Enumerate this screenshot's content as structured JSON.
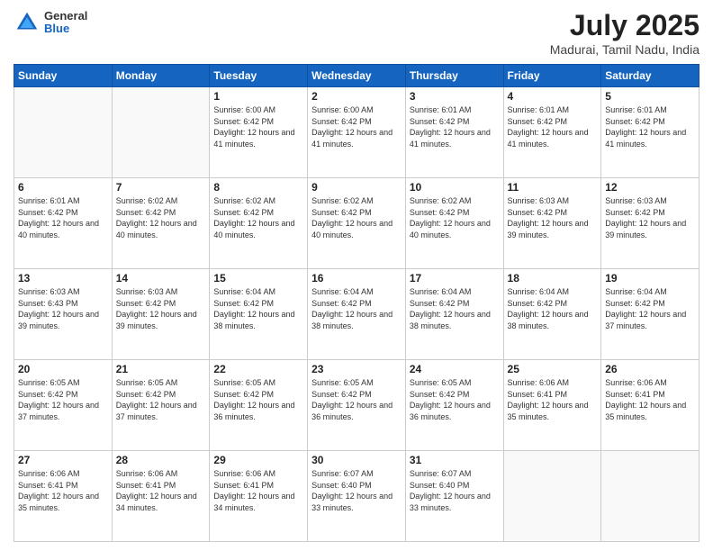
{
  "header": {
    "logo_general": "General",
    "logo_blue": "Blue",
    "title": "July 2025",
    "location": "Madurai, Tamil Nadu, India"
  },
  "weekdays": [
    "Sunday",
    "Monday",
    "Tuesday",
    "Wednesday",
    "Thursday",
    "Friday",
    "Saturday"
  ],
  "weeks": [
    [
      {
        "day": "",
        "sunrise": "",
        "sunset": "",
        "daylight": ""
      },
      {
        "day": "",
        "sunrise": "",
        "sunset": "",
        "daylight": ""
      },
      {
        "day": "1",
        "sunrise": "Sunrise: 6:00 AM",
        "sunset": "Sunset: 6:42 PM",
        "daylight": "Daylight: 12 hours and 41 minutes."
      },
      {
        "day": "2",
        "sunrise": "Sunrise: 6:00 AM",
        "sunset": "Sunset: 6:42 PM",
        "daylight": "Daylight: 12 hours and 41 minutes."
      },
      {
        "day": "3",
        "sunrise": "Sunrise: 6:01 AM",
        "sunset": "Sunset: 6:42 PM",
        "daylight": "Daylight: 12 hours and 41 minutes."
      },
      {
        "day": "4",
        "sunrise": "Sunrise: 6:01 AM",
        "sunset": "Sunset: 6:42 PM",
        "daylight": "Daylight: 12 hours and 41 minutes."
      },
      {
        "day": "5",
        "sunrise": "Sunrise: 6:01 AM",
        "sunset": "Sunset: 6:42 PM",
        "daylight": "Daylight: 12 hours and 41 minutes."
      }
    ],
    [
      {
        "day": "6",
        "sunrise": "Sunrise: 6:01 AM",
        "sunset": "Sunset: 6:42 PM",
        "daylight": "Daylight: 12 hours and 40 minutes."
      },
      {
        "day": "7",
        "sunrise": "Sunrise: 6:02 AM",
        "sunset": "Sunset: 6:42 PM",
        "daylight": "Daylight: 12 hours and 40 minutes."
      },
      {
        "day": "8",
        "sunrise": "Sunrise: 6:02 AM",
        "sunset": "Sunset: 6:42 PM",
        "daylight": "Daylight: 12 hours and 40 minutes."
      },
      {
        "day": "9",
        "sunrise": "Sunrise: 6:02 AM",
        "sunset": "Sunset: 6:42 PM",
        "daylight": "Daylight: 12 hours and 40 minutes."
      },
      {
        "day": "10",
        "sunrise": "Sunrise: 6:02 AM",
        "sunset": "Sunset: 6:42 PM",
        "daylight": "Daylight: 12 hours and 40 minutes."
      },
      {
        "day": "11",
        "sunrise": "Sunrise: 6:03 AM",
        "sunset": "Sunset: 6:42 PM",
        "daylight": "Daylight: 12 hours and 39 minutes."
      },
      {
        "day": "12",
        "sunrise": "Sunrise: 6:03 AM",
        "sunset": "Sunset: 6:42 PM",
        "daylight": "Daylight: 12 hours and 39 minutes."
      }
    ],
    [
      {
        "day": "13",
        "sunrise": "Sunrise: 6:03 AM",
        "sunset": "Sunset: 6:43 PM",
        "daylight": "Daylight: 12 hours and 39 minutes."
      },
      {
        "day": "14",
        "sunrise": "Sunrise: 6:03 AM",
        "sunset": "Sunset: 6:42 PM",
        "daylight": "Daylight: 12 hours and 39 minutes."
      },
      {
        "day": "15",
        "sunrise": "Sunrise: 6:04 AM",
        "sunset": "Sunset: 6:42 PM",
        "daylight": "Daylight: 12 hours and 38 minutes."
      },
      {
        "day": "16",
        "sunrise": "Sunrise: 6:04 AM",
        "sunset": "Sunset: 6:42 PM",
        "daylight": "Daylight: 12 hours and 38 minutes."
      },
      {
        "day": "17",
        "sunrise": "Sunrise: 6:04 AM",
        "sunset": "Sunset: 6:42 PM",
        "daylight": "Daylight: 12 hours and 38 minutes."
      },
      {
        "day": "18",
        "sunrise": "Sunrise: 6:04 AM",
        "sunset": "Sunset: 6:42 PM",
        "daylight": "Daylight: 12 hours and 38 minutes."
      },
      {
        "day": "19",
        "sunrise": "Sunrise: 6:04 AM",
        "sunset": "Sunset: 6:42 PM",
        "daylight": "Daylight: 12 hours and 37 minutes."
      }
    ],
    [
      {
        "day": "20",
        "sunrise": "Sunrise: 6:05 AM",
        "sunset": "Sunset: 6:42 PM",
        "daylight": "Daylight: 12 hours and 37 minutes."
      },
      {
        "day": "21",
        "sunrise": "Sunrise: 6:05 AM",
        "sunset": "Sunset: 6:42 PM",
        "daylight": "Daylight: 12 hours and 37 minutes."
      },
      {
        "day": "22",
        "sunrise": "Sunrise: 6:05 AM",
        "sunset": "Sunset: 6:42 PM",
        "daylight": "Daylight: 12 hours and 36 minutes."
      },
      {
        "day": "23",
        "sunrise": "Sunrise: 6:05 AM",
        "sunset": "Sunset: 6:42 PM",
        "daylight": "Daylight: 12 hours and 36 minutes."
      },
      {
        "day": "24",
        "sunrise": "Sunrise: 6:05 AM",
        "sunset": "Sunset: 6:42 PM",
        "daylight": "Daylight: 12 hours and 36 minutes."
      },
      {
        "day": "25",
        "sunrise": "Sunrise: 6:06 AM",
        "sunset": "Sunset: 6:41 PM",
        "daylight": "Daylight: 12 hours and 35 minutes."
      },
      {
        "day": "26",
        "sunrise": "Sunrise: 6:06 AM",
        "sunset": "Sunset: 6:41 PM",
        "daylight": "Daylight: 12 hours and 35 minutes."
      }
    ],
    [
      {
        "day": "27",
        "sunrise": "Sunrise: 6:06 AM",
        "sunset": "Sunset: 6:41 PM",
        "daylight": "Daylight: 12 hours and 35 minutes."
      },
      {
        "day": "28",
        "sunrise": "Sunrise: 6:06 AM",
        "sunset": "Sunset: 6:41 PM",
        "daylight": "Daylight: 12 hours and 34 minutes."
      },
      {
        "day": "29",
        "sunrise": "Sunrise: 6:06 AM",
        "sunset": "Sunset: 6:41 PM",
        "daylight": "Daylight: 12 hours and 34 minutes."
      },
      {
        "day": "30",
        "sunrise": "Sunrise: 6:07 AM",
        "sunset": "Sunset: 6:40 PM",
        "daylight": "Daylight: 12 hours and 33 minutes."
      },
      {
        "day": "31",
        "sunrise": "Sunrise: 6:07 AM",
        "sunset": "Sunset: 6:40 PM",
        "daylight": "Daylight: 12 hours and 33 minutes."
      },
      {
        "day": "",
        "sunrise": "",
        "sunset": "",
        "daylight": ""
      },
      {
        "day": "",
        "sunrise": "",
        "sunset": "",
        "daylight": ""
      }
    ]
  ]
}
